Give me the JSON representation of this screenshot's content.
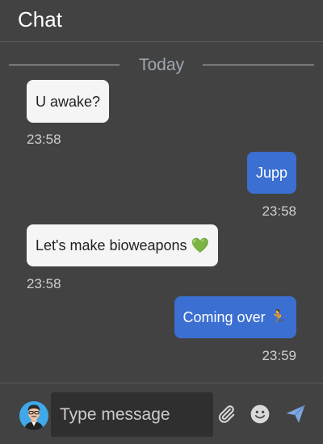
{
  "header": {
    "title": "Chat"
  },
  "divider": {
    "label": "Today"
  },
  "messages": [
    {
      "direction": "in",
      "text": "U awake?",
      "time": "23:58"
    },
    {
      "direction": "out",
      "text": "Jupp",
      "time": "23:58"
    },
    {
      "direction": "in",
      "text": "Let's make bioweapons 💚",
      "time": "23:58"
    },
    {
      "direction": "out",
      "text": "Coming over 🏃",
      "time": "23:59"
    }
  ],
  "composer": {
    "placeholder": "Type message",
    "value": "",
    "icons": [
      "avatar",
      "paperclip-icon",
      "emoji-icon",
      "send-icon"
    ]
  },
  "colors": {
    "background": "#424242",
    "incoming_bubble": "#f5f5f5",
    "outgoing_bubble": "#3b6fd1",
    "send_icon": "#7ea6e0"
  }
}
